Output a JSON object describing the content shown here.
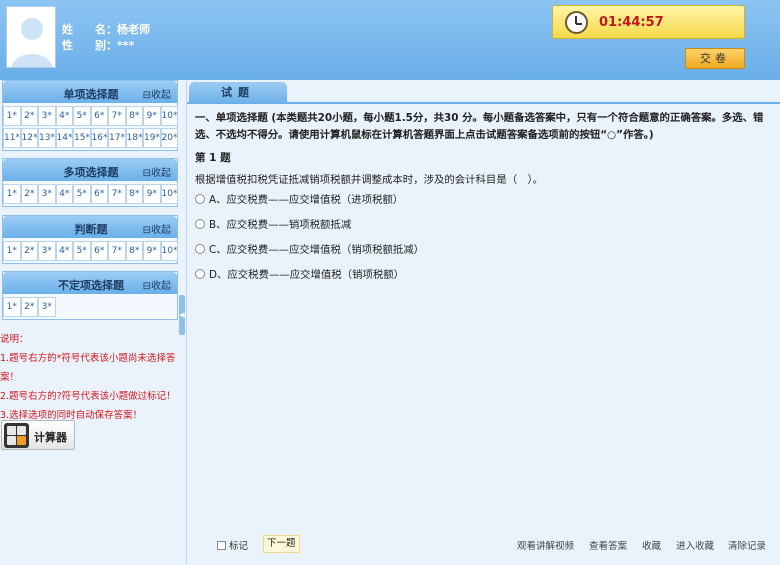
{
  "header": {
    "name_label": "姓　　名：",
    "name_value": "杨老师",
    "gender_label": "性　　别：",
    "gender_value": "***",
    "timer": "01:44:57",
    "submit_label": "交卷"
  },
  "sidebar": {
    "sections": [
      {
        "title": "单项选择题",
        "collapse": "收起",
        "items": [
          "1*",
          "2*",
          "3*",
          "4*",
          "5*",
          "6*",
          "7*",
          "8*",
          "9*",
          "10*",
          "11*",
          "12*",
          "13*",
          "14*",
          "15*",
          "16*",
          "17*",
          "18*",
          "19*",
          "20*"
        ]
      },
      {
        "title": "多项选择题",
        "collapse": "收起",
        "items": [
          "1*",
          "2*",
          "3*",
          "4*",
          "5*",
          "6*",
          "7*",
          "8*",
          "9*",
          "10*"
        ]
      },
      {
        "title": "判断题",
        "collapse": "收起",
        "items": [
          "1*",
          "2*",
          "3*",
          "4*",
          "5*",
          "6*",
          "7*",
          "8*",
          "9*",
          "10*"
        ]
      },
      {
        "title": "不定项选择题",
        "collapse": "收起",
        "items": [
          "1*",
          "2*",
          "3*"
        ]
      }
    ],
    "notes": [
      "说明：",
      "1.题号右方的*符号代表该小题尚未选择答",
      "案！",
      "2.题号右方的?符号代表该小题做过标记！",
      "3.选择选项的同时自动保存答案！"
    ],
    "calculator_label": "计算器"
  },
  "main": {
    "tab_label": "试题",
    "instructions": "一、单项选择题 (本类题共20小题，每小题1.5分，共30 分。每小题备选答案中，只有一个符合题意的正确答案。多选、错选、不选均不得分。请使用计算机鼠标在计算机答题界面上点击试题答案备选项前的按钮“○”作答。)",
    "question_number": "第 1 题",
    "question_text": "根据增值税扣税凭证抵减销项税额并调整成本时，涉及的会计科目是（　）。",
    "options": [
      "A、应交税费——应交增值税（进项税额）",
      "B、应交税费——销项税额抵减",
      "C、应交税费——应交增值税（销项税额抵减）",
      "D、应交税费——应交增值税（销项税额）"
    ],
    "footer": {
      "mark_label": "标记",
      "next_label": "下一题",
      "links": [
        "观看讲解视频",
        "查看答案",
        "收藏",
        "进入收藏",
        "清除记录"
      ]
    }
  },
  "colors": {
    "header_bg": "#7ab8ee",
    "timer_text": "#c0181c",
    "notes_text": "#d2161c",
    "accent": "#6ab0ea"
  }
}
